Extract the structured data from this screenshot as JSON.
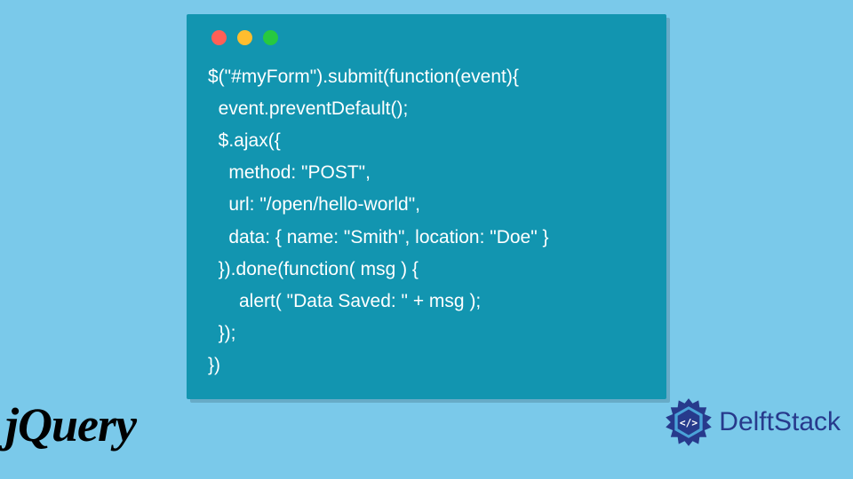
{
  "code": {
    "lines": [
      "$(\"#myForm\").submit(function(event){",
      "  event.preventDefault();",
      "  $.ajax({",
      "    method: \"POST\",",
      "    url: \"/open/hello-world\",",
      "    data: { name: \"Smith\", location: \"Doe\" }",
      "  }).done(function( msg ) {",
      "      alert( \"Data Saved: \" + msg );",
      "  });",
      "})"
    ]
  },
  "logos": {
    "jquery": "jQuery",
    "delft_part1": "Delft",
    "delft_part2": "Stack"
  },
  "colors": {
    "bg": "#7ac9ea",
    "card": "#1295b0",
    "dot_red": "#ff5f56",
    "dot_yellow": "#ffbd2e",
    "dot_green": "#27c93f",
    "delft_blue": "#273a8c"
  }
}
